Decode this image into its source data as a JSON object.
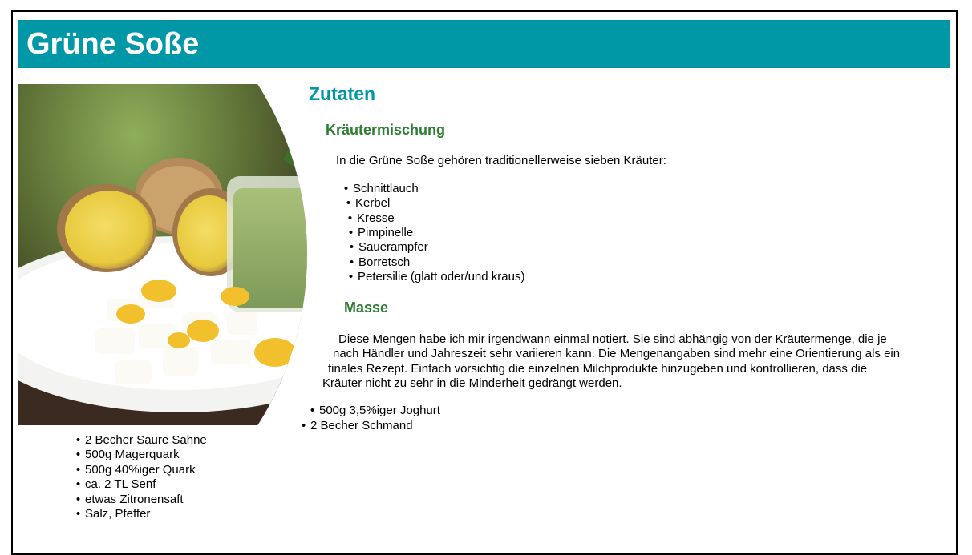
{
  "page": {
    "title": "Grüne Soße"
  },
  "image": {
    "alt_icon": "recipe-photo"
  },
  "ingredients": {
    "heading": "Zutaten",
    "herbs": {
      "heading": "Kräutermischung",
      "intro": "In die Grüne Soße gehören traditionellerweise sieben Kräuter:",
      "items": [
        "Schnittlauch",
        "Kerbel",
        "Kresse",
        "Pimpinelle",
        "Sauerampfer",
        "Borretsch",
        "Petersilie (glatt oder/und kraus)"
      ]
    },
    "mass": {
      "heading": "Masse",
      "lines": [
        "Diese Mengen habe ich mir irgendwann einmal notiert. Sie sind abhängig von der Kräutermenge, die je",
        "nach Händler und Jahreszeit sehr variieren kann. Die Mengenangaben sind mehr eine Orientierung als ein",
        "finales Rezept. Einfach vorsichtig die einzelnen Milchprodukte hinzugeben und kontrollieren, dass die",
        "Kräuter nicht zu sehr in die Minderheit gedrängt werden."
      ],
      "items": [
        "500g 3,5%iger Joghurt",
        "2 Becher Schmand",
        "2 Becher Saure Sahne",
        "500g Magerquark",
        "500g 40%iger Quark",
        "ca. 2 TL Senf",
        "etwas Zitronensaft",
        "Salz, Pfeffer"
      ]
    }
  }
}
